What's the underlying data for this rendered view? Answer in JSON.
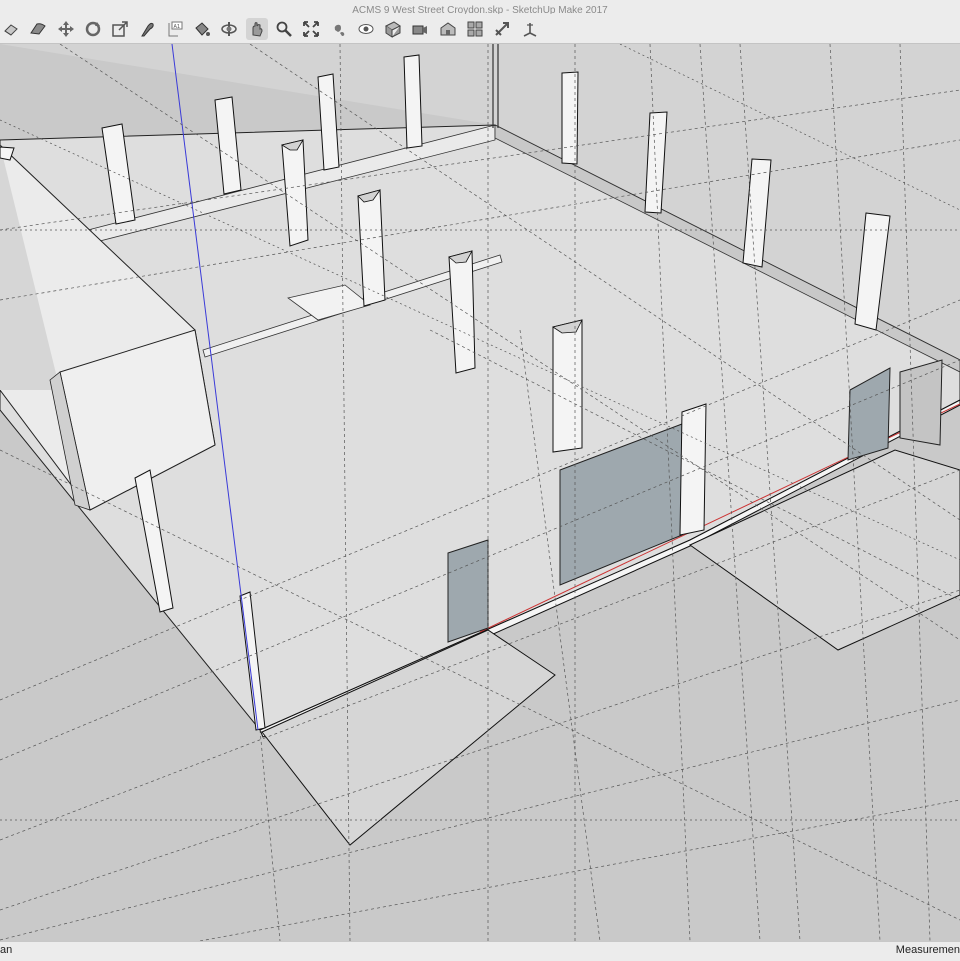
{
  "window": {
    "title": "ACMS 9 West Street Croydon.skp - SketchUp Make 2017"
  },
  "toolbar": {
    "tools": [
      {
        "name": "select-icon"
      },
      {
        "name": "eraser-icon"
      },
      {
        "name": "move-icon"
      },
      {
        "name": "rotate-icon"
      },
      {
        "name": "scale-icon"
      },
      {
        "name": "tape-measure-icon"
      },
      {
        "name": "dimension-icon"
      },
      {
        "name": "paint-bucket-icon"
      },
      {
        "name": "orbit-icon"
      },
      {
        "name": "pan-icon"
      },
      {
        "name": "zoom-icon"
      },
      {
        "name": "zoom-extents-icon"
      },
      {
        "name": "walk-icon"
      },
      {
        "name": "look-around-icon"
      },
      {
        "name": "section-plane-icon"
      },
      {
        "name": "position-camera-icon"
      },
      {
        "name": "warehouse-icon"
      },
      {
        "name": "components-icon"
      },
      {
        "name": "extension-icon"
      },
      {
        "name": "axes-icon"
      }
    ]
  },
  "statusbar": {
    "left": "an",
    "right": "Measuremen"
  },
  "colors": {
    "window_pane": "#9ea8ae",
    "axis_blue": "#3a3ad8",
    "axis_red": "#cc3333",
    "ground": "#c9c9c9",
    "floor": "#dcdcdc"
  }
}
